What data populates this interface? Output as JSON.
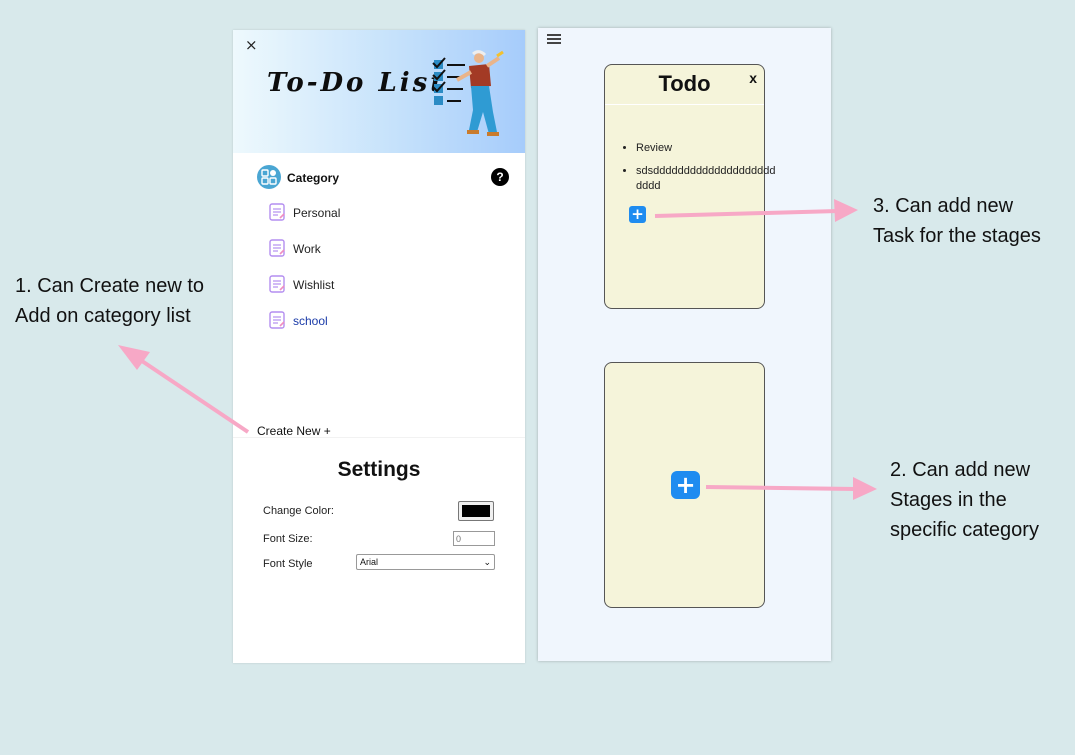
{
  "sidebar": {
    "close_icon": "×",
    "banner_title": "To-Do List",
    "category_label": "Category",
    "help_label": "?",
    "categories": [
      {
        "label": "Personal"
      },
      {
        "label": "Work"
      },
      {
        "label": "Wishlist"
      },
      {
        "label": "school"
      }
    ],
    "create_new_label": "Create New +"
  },
  "settings": {
    "title": "Settings",
    "change_color_label": "Change Color:",
    "color_value": "#000000",
    "font_size_label": "Font Size:",
    "font_size_placeholder": "0",
    "font_style_label": "Font Style",
    "font_style_value": "Arial"
  },
  "board": {
    "stage": {
      "title": "Todo",
      "close_label": "x",
      "tasks": [
        {
          "text": "Review"
        },
        {
          "text": "sdsdddddddddddddddddddddddd"
        }
      ],
      "add_task_label": "+"
    },
    "add_stage_label": "+"
  },
  "annotations": {
    "note1_line1": "1. Can Create new to",
    "note1_line2": "Add on category list",
    "note2_line1": "2. Can add new",
    "note2_line2": "Stages in the",
    "note2_line3": "specific category",
    "note3_line1": "3. Can add new",
    "note3_line2": "Task for the stages"
  },
  "colors": {
    "page_bg": "#d8e9eb",
    "stage_bg": "#f5f4da",
    "accent_blue": "#1f8cf0",
    "arrow_pink": "#f7a8c6",
    "link_blue": "#1a3aa8"
  },
  "icons": [
    "close-icon",
    "checklist-illustration",
    "category-grid-icon",
    "help-icon",
    "note-icon",
    "menu-icon",
    "plus-icon"
  ]
}
